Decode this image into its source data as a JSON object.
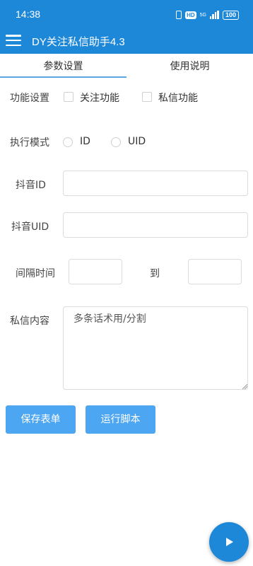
{
  "status_bar": {
    "time": "14:38",
    "hd": "HD",
    "network": "5G",
    "battery": "100"
  },
  "app_bar": {
    "title": "DY关注私信助手4.3"
  },
  "tabs": [
    {
      "label": "参数设置",
      "active": true
    },
    {
      "label": "使用说明",
      "active": false
    }
  ],
  "form": {
    "function_setting": {
      "label": "功能设置",
      "options": [
        {
          "label": "关注功能",
          "checked": false
        },
        {
          "label": "私信功能",
          "checked": false
        }
      ]
    },
    "exec_mode": {
      "label": "执行模式",
      "options": [
        {
          "label": "ID",
          "selected": false
        },
        {
          "label": "UID",
          "selected": false
        }
      ]
    },
    "douyin_id": {
      "label": "抖音ID",
      "value": ""
    },
    "douyin_uid": {
      "label": "抖音UID",
      "value": ""
    },
    "interval": {
      "label": "间隔时间",
      "to_label": "到",
      "from_value": "",
      "to_value": ""
    },
    "message": {
      "label": "私信内容",
      "placeholder": "多条话术用/分割"
    }
  },
  "buttons": {
    "save": "保存表单",
    "run": "运行脚本"
  },
  "colors": {
    "primary": "#1e88d8",
    "button": "#4da6f2",
    "tab_indicator": "#5aa7e6"
  },
  "icons": {
    "menu": "hamburger-menu-icon",
    "fab": "play-icon"
  }
}
